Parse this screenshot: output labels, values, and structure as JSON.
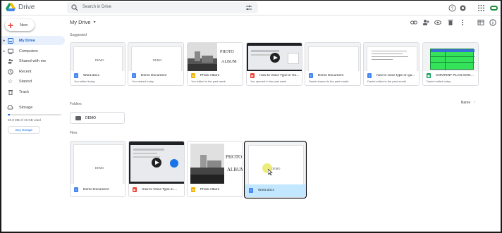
{
  "app": {
    "name": "Drive"
  },
  "search": {
    "placeholder": "Search in Drive"
  },
  "sidebar": {
    "new_label": "New",
    "items": [
      {
        "label": "My Drive",
        "icon": "drive-icon",
        "active": true
      },
      {
        "label": "Computers",
        "icon": "computer-icon"
      },
      {
        "label": "Shared with me",
        "icon": "people-icon"
      },
      {
        "label": "Recent",
        "icon": "clock-icon"
      },
      {
        "label": "Starred",
        "icon": "star-icon"
      },
      {
        "label": "Trash",
        "icon": "trash-icon"
      },
      {
        "label": "Storage",
        "icon": "cloud-icon"
      }
    ],
    "storage_text": "20.8 MB of 15 GB used",
    "storage_fraction": 0.04,
    "buy_storage": "Buy storage"
  },
  "main": {
    "title": "My Drive",
    "suggested_label": "Suggested",
    "folders_label": "Folders",
    "files_label": "Files",
    "sort_label": "Name",
    "suggested": [
      {
        "name": "Word.docx",
        "sub": "You edited today",
        "type": "doc",
        "thumb": "DEMO"
      },
      {
        "name": "Demo Document",
        "sub": "You shared today",
        "type": "doc",
        "thumb": "DEMO"
      },
      {
        "name": "Photo Album",
        "sub": "You edited in the past week",
        "type": "slide",
        "thumb": ""
      },
      {
        "name": "How to Voice Type in Go...",
        "sub": "You opened in the past week",
        "type": "vid",
        "thumb": ""
      },
      {
        "name": "Demo Document",
        "sub": "Daniel shared in the past month",
        "type": "doc",
        "thumb": ""
      },
      {
        "name": "how to voice type on go...",
        "sub": "Daniel edited in the past month",
        "type": "doc",
        "thumb": ""
      },
      {
        "name": "CONTENT PLAN GOOOO...",
        "sub": "Daniel edited today",
        "type": "sheet",
        "thumb": ""
      }
    ],
    "folders": [
      {
        "name": "DEMO"
      }
    ],
    "files": [
      {
        "name": "Demo Document",
        "type": "doc",
        "thumb": "DEMO"
      },
      {
        "name": "How to Voice Type in ...",
        "type": "vid",
        "thumb": ""
      },
      {
        "name": "Photo Album",
        "type": "slide",
        "thumb": ""
      },
      {
        "name": "Word.docx",
        "type": "doc",
        "thumb": "DEMO"
      }
    ],
    "photo_words": [
      "PHOTO",
      "ALBUM"
    ]
  }
}
